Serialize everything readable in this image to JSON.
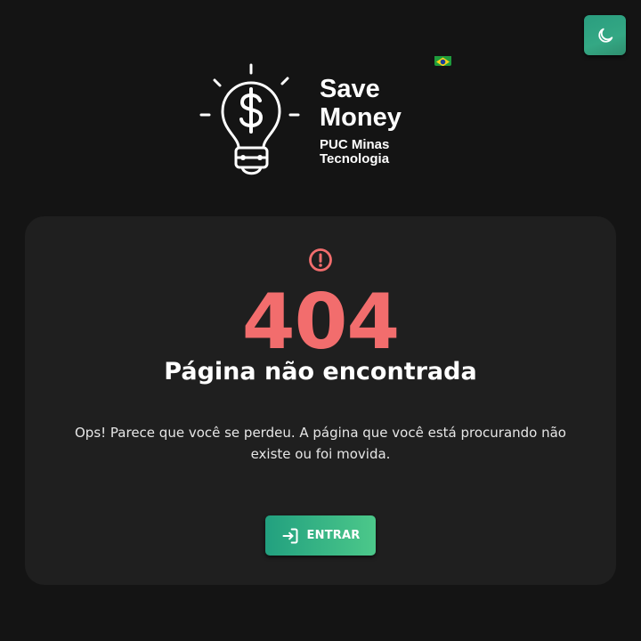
{
  "header": {
    "theme_toggle_icon": "moon-icon",
    "language_flag": "brazil-flag-icon",
    "brand": {
      "logo_icon": "lightbulb-dollar-icon",
      "title": "Save Money",
      "subtitle": "PUC Minas Tecnologia"
    }
  },
  "error": {
    "icon": "alert-circle-icon",
    "code": "404",
    "title": "Página não encontrada",
    "message": "Ops! Parece que você se perdeu. A página que você está procurando não existe ou foi movida."
  },
  "actions": {
    "login_icon": "login-icon",
    "login_label": "ENTRAR"
  },
  "colors": {
    "background": "#141414",
    "card": "#1f1f1f",
    "error_red": "#f26d6d",
    "accent_green": "#34a884"
  }
}
